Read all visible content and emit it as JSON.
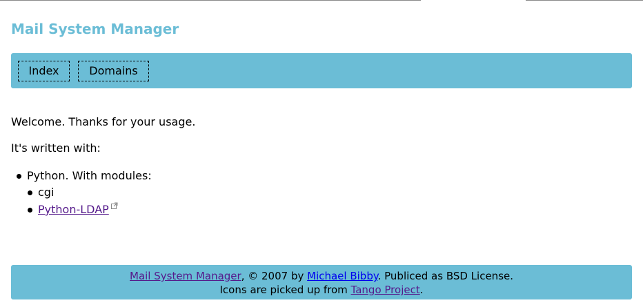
{
  "app": {
    "title": "Mail System Manager"
  },
  "nav": {
    "items": [
      {
        "label": "Index"
      },
      {
        "label": "Domains"
      }
    ]
  },
  "main": {
    "welcome": "Welcome. Thanks for your usage.",
    "written_with": "It's written with:",
    "list": {
      "python": "Python. With modules:",
      "modules": [
        {
          "label": "cgi"
        },
        {
          "label": "Python-LDAP",
          "external_icon": "external-link-icon"
        }
      ]
    }
  },
  "footer": {
    "line1": {
      "project_link": "Mail System Manager",
      "copyright": ", © 2007 by ",
      "author_link": "Michael Bibby",
      "license": ". Publiced as BSD License."
    },
    "line2": {
      "prefix": "Icons are picked up from ",
      "tango_link": "Tango Project",
      "suffix": "."
    }
  },
  "colors": {
    "accent": "#6bbdd6",
    "visited_link": "#551a8b",
    "link": "#0000ee"
  }
}
